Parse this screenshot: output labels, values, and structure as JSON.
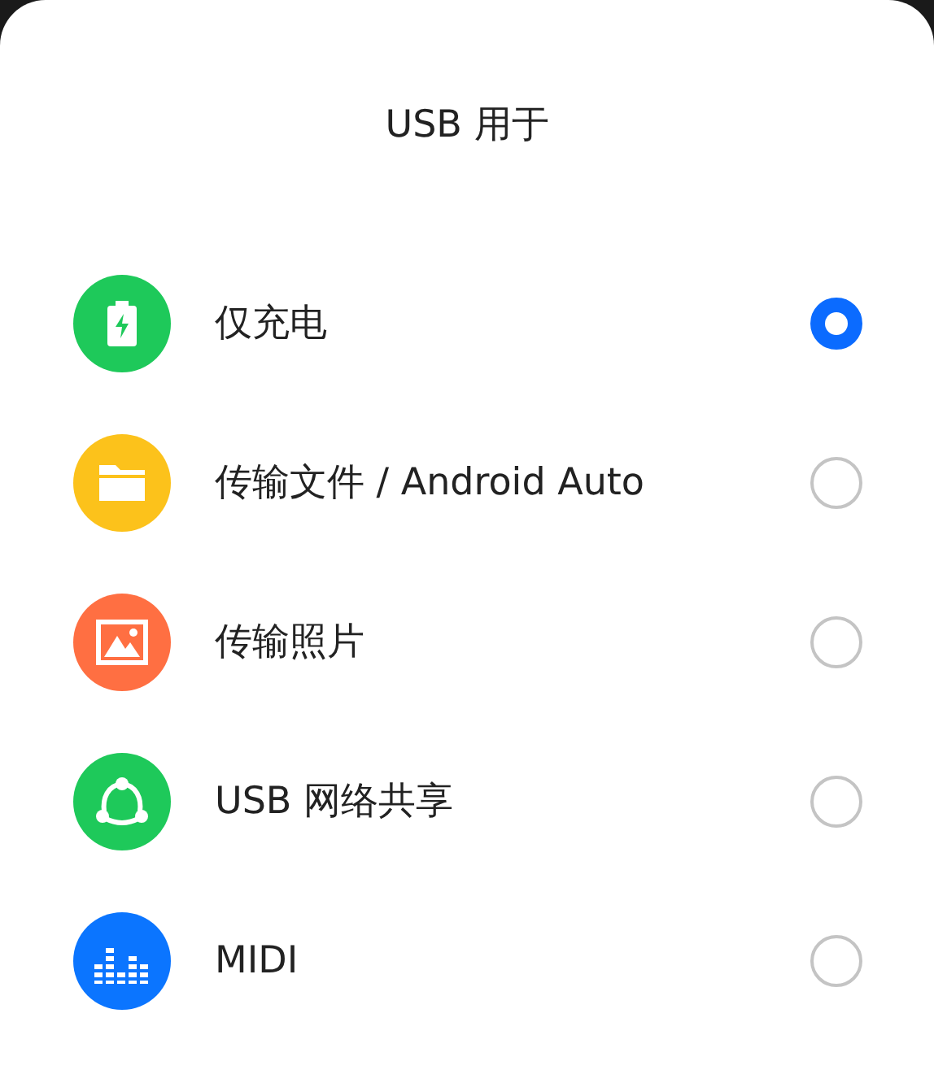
{
  "dialog": {
    "title": "USB 用于"
  },
  "options": [
    {
      "label": "仅充电",
      "kind": "battery",
      "color": "#1ec95a",
      "selected": true
    },
    {
      "label": "传输文件 / Android Auto",
      "kind": "folder",
      "color": "#fcc21b",
      "selected": false
    },
    {
      "label": "传输照片",
      "kind": "photo",
      "color": "#ff6f42",
      "selected": false
    },
    {
      "label": "USB 网络共享",
      "kind": "share",
      "color": "#1ec95a",
      "selected": false
    },
    {
      "label": "MIDI",
      "kind": "equalizer",
      "color": "#0b75ff",
      "selected": false
    }
  ]
}
